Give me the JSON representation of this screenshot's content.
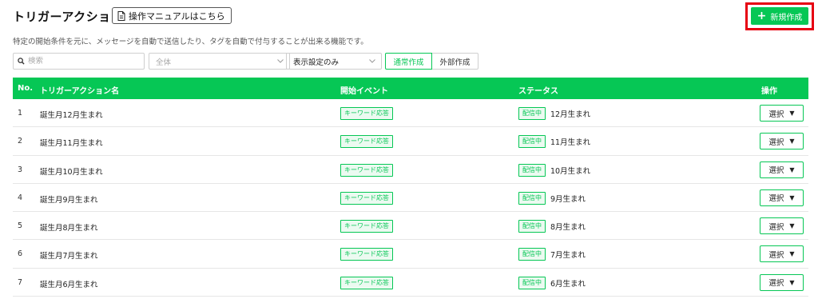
{
  "header": {
    "title": "トリガーアクション",
    "manual_button": "操作マニュアルはこちら",
    "new_button": "新規作成",
    "description": "特定の開始条件を元に、メッセージを自動で送信したり、タグを自動で付与することが出来る機能です。"
  },
  "filters": {
    "search_placeholder": "検索",
    "category_select": "全体",
    "display_select": "表示設定のみ",
    "tabs": [
      "通常作成",
      "外部作成"
    ],
    "active_tab": "通常作成"
  },
  "table": {
    "columns": [
      "No.",
      "トリガーアクション名",
      "開始イベント",
      "ステータス",
      "操作"
    ],
    "rows": [
      {
        "no": "1",
        "name": "誕生月12月生まれ",
        "event": "キーワード応答",
        "status_badge": "配信中",
        "status_label": "12月生まれ",
        "action": "選択"
      },
      {
        "no": "2",
        "name": "誕生月11月生まれ",
        "event": "キーワード応答",
        "status_badge": "配信中",
        "status_label": "11月生まれ",
        "action": "選択"
      },
      {
        "no": "3",
        "name": "誕生月10月生まれ",
        "event": "キーワード応答",
        "status_badge": "配信中",
        "status_label": "10月生まれ",
        "action": "選択"
      },
      {
        "no": "4",
        "name": "誕生月9月生まれ",
        "event": "キーワード応答",
        "status_badge": "配信中",
        "status_label": "9月生まれ",
        "action": "選択"
      },
      {
        "no": "5",
        "name": "誕生月8月生まれ",
        "event": "キーワード応答",
        "status_badge": "配信中",
        "status_label": "8月生まれ",
        "action": "選択"
      },
      {
        "no": "6",
        "name": "誕生月7月生まれ",
        "event": "キーワード応答",
        "status_badge": "配信中",
        "status_label": "7月生まれ",
        "action": "選択"
      },
      {
        "no": "7",
        "name": "誕生月6月生まれ",
        "event": "キーワード応答",
        "status_badge": "配信中",
        "status_label": "6月生まれ",
        "action": "選択"
      }
    ]
  },
  "colors": {
    "accent": "#06c755",
    "highlight_outline": "#e60012"
  },
  "icons": {
    "manual": "document-icon",
    "new": "plus-icon",
    "search": "search-icon",
    "select": "chevron-down-icon",
    "row_action": "caret-down-icon"
  }
}
